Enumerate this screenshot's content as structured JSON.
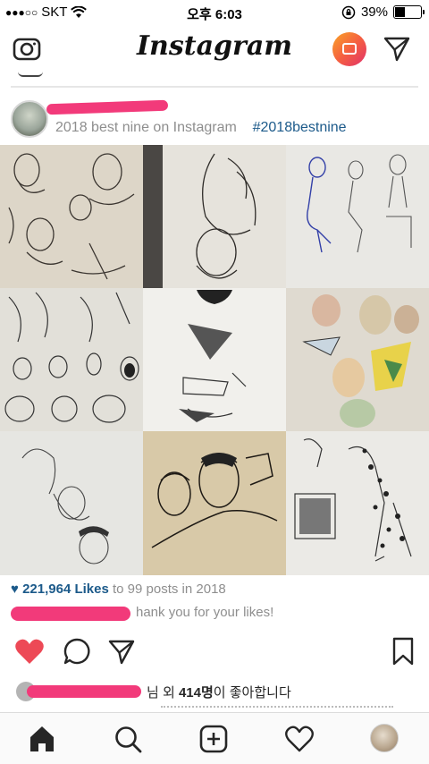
{
  "status_bar": {
    "carrier": "SKT",
    "time": "오후 6:03",
    "battery": "39%",
    "battery_level": 0.39
  },
  "header": {
    "logo": "Instagram",
    "icons": [
      "camera-icon",
      "igtv-icon",
      "direct-message-icon"
    ]
  },
  "post": {
    "caption_text": "2018 best nine on Instagram",
    "hashtag": "#2018bestnine",
    "grid_tiles": 9,
    "likes_count": "221,964 Likes",
    "likes_suffix": "to 99 posts in 2018",
    "thanks_text": "hank you for your likes!",
    "liked_by_suffix": "님 외",
    "liked_by_count": "414명",
    "liked_by_end": "이 좋아합니다",
    "liked": true,
    "accent_color": "#ed4956",
    "link_color": "#1c5a8a"
  },
  "action_icons": [
    "heart-icon",
    "comment-icon",
    "share-icon",
    "bookmark-icon"
  ],
  "tab_bar": {
    "tabs": [
      "home-icon",
      "search-icon",
      "add-icon",
      "activity-icon",
      "profile-avatar"
    ]
  }
}
